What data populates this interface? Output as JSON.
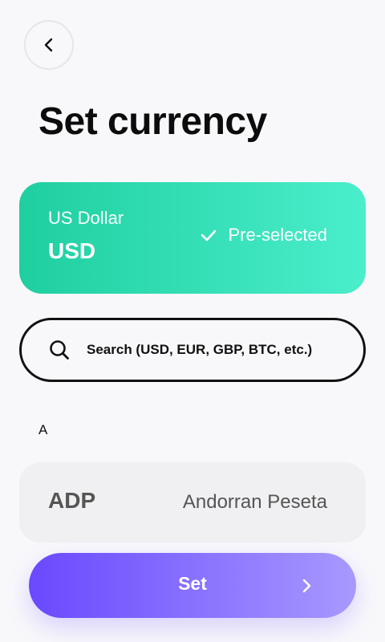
{
  "header": {
    "title": "Set currency"
  },
  "selected_currency": {
    "name": "US Dollar",
    "code": "USD",
    "status": "Pre-selected",
    "gradient": [
      "#1fcfa0",
      "#4aeecb"
    ]
  },
  "search": {
    "placeholder": "Search (USD, EUR, GBP, BTC, etc.)",
    "value": ""
  },
  "list": {
    "sections": [
      {
        "letter": "A",
        "items": [
          {
            "code": "ADP",
            "name": "Andorran Peseta"
          }
        ]
      }
    ]
  },
  "footer": {
    "set_label": "Set",
    "gradient": [
      "#6a48ff",
      "#a799ff"
    ]
  },
  "icons": {
    "back": "chevron-left-icon",
    "check": "check-icon",
    "search": "search-icon",
    "next": "chevron-right-icon"
  }
}
